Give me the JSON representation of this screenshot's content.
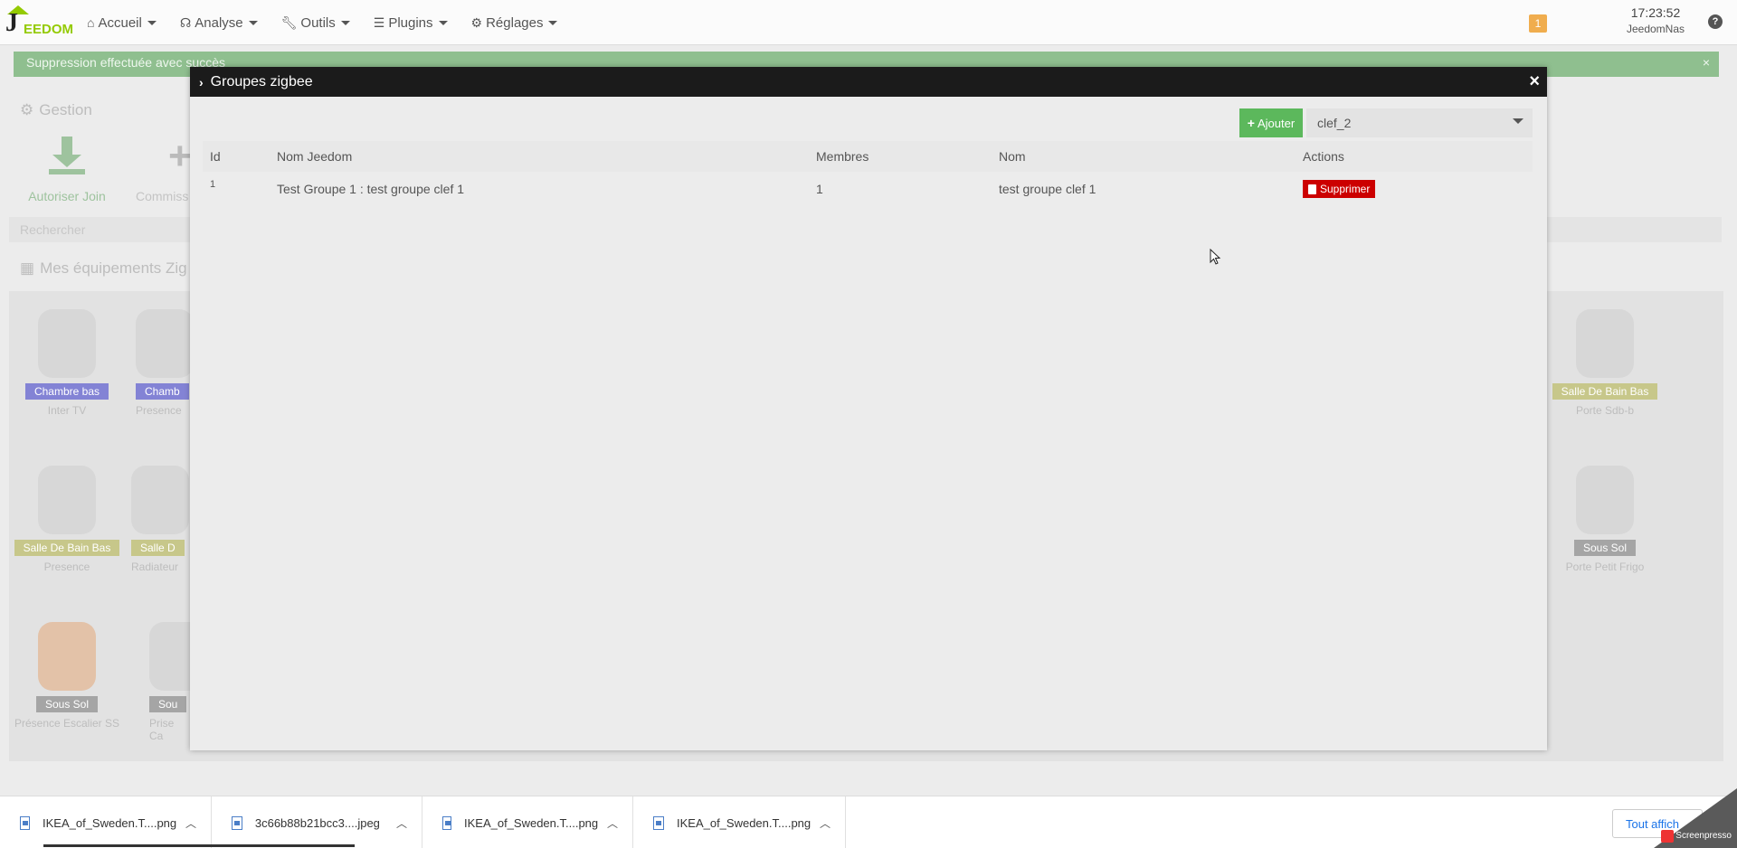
{
  "navbar": {
    "logo_text": "EEDOM",
    "items": [
      {
        "label": "Accueil",
        "icon": "home-icon"
      },
      {
        "label": "Analyse",
        "icon": "stethoscope-icon"
      },
      {
        "label": "Outils",
        "icon": "wrench-icon"
      },
      {
        "label": "Plugins",
        "icon": "list-icon"
      },
      {
        "label": "Réglages",
        "icon": "gear-icon"
      }
    ],
    "alert_count": "1",
    "time": "17:23:52",
    "hostname": "JeedomNas",
    "help_icon": "?"
  },
  "success_alert": {
    "text": "Suppression effectuée avec succès",
    "close": "×"
  },
  "background": {
    "gestion_title": "Gestion",
    "join_label": "Autoriser Join",
    "commission_label": "Commiss",
    "search_placeholder": "Rechercher",
    "equipments_title": "Mes équipements Zig",
    "equipments": [
      {
        "badge": "Chambre bas",
        "name": "Inter TV",
        "color": "#8383d5"
      },
      {
        "badge": "Chamb",
        "name": "Presence",
        "color": "#8383d5"
      },
      {
        "badge": "Salle De Bain Bas",
        "name": "Porte Sdb-b",
        "color": "#c7c78a"
      },
      {
        "badge": "Salle De Bain Bas",
        "name": "Presence",
        "color": "#c7c78a"
      },
      {
        "badge": "Salle D",
        "name": "Radiateur",
        "color": "#c7c78a"
      },
      {
        "badge": "Sous Sol",
        "name": "Porte Petit Frigo",
        "color": "#a5a5a5"
      },
      {
        "badge": "Sous Sol",
        "name": "Présence Escalier SS",
        "color": "#a5a5a5"
      },
      {
        "badge": "Sou",
        "name": "Prise Ca",
        "color": "#a5a5a5"
      }
    ]
  },
  "modal": {
    "title": "Groupes zigbee",
    "close": "×",
    "add_button": "Ajouter",
    "selected_key": "clef_2",
    "columns": [
      "Id",
      "Nom Jeedom",
      "Membres",
      "Nom",
      "Actions"
    ],
    "rows": [
      {
        "id": "1",
        "nom_jeedom": "Test Groupe 1 : test groupe clef 1",
        "membres": "1",
        "nom": "test groupe clef 1",
        "action": "Supprimer"
      }
    ]
  },
  "downloads": {
    "files": [
      "IKEA_of_Sweden.T....png",
      "3c66b88b21bcc3....jpeg",
      "IKEA_of_Sweden.T....png",
      "IKEA_of_Sweden.T....png"
    ],
    "show_all": "Tout affich",
    "watermark": "Screenpresso"
  },
  "colors": {
    "success": "#5cb85c",
    "danger": "#cc0000",
    "modal_header": "#1b1b1b",
    "warning": "#f0ad4e"
  }
}
